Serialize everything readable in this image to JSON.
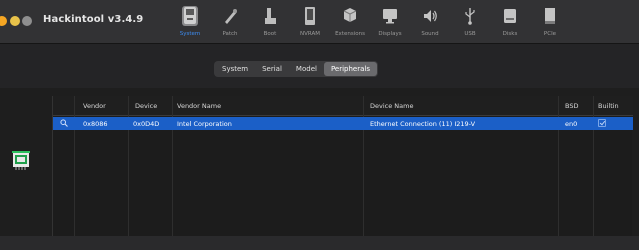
{
  "app": {
    "title": "Hackintool v3.4.9"
  },
  "toolbar": {
    "items": [
      {
        "label": "System",
        "icon": "system-icon",
        "active": true
      },
      {
        "label": "Patch",
        "icon": "patch-icon"
      },
      {
        "label": "Boot",
        "icon": "boot-icon"
      },
      {
        "label": "NVRAM",
        "icon": "nvram-icon"
      },
      {
        "label": "Extensions",
        "icon": "extensions-icon"
      },
      {
        "label": "Displays",
        "icon": "displays-icon"
      },
      {
        "label": "Sound",
        "icon": "sound-icon"
      },
      {
        "label": "USB",
        "icon": "usb-icon"
      },
      {
        "label": "Disks",
        "icon": "disks-icon"
      },
      {
        "label": "PCIe",
        "icon": "pcie-icon"
      }
    ],
    "accent": "#3d8cf0"
  },
  "tabs": {
    "items": [
      {
        "label": "System"
      },
      {
        "label": "Serial"
      },
      {
        "label": "Model"
      },
      {
        "label": "Peripherals",
        "active": true
      }
    ]
  },
  "table": {
    "columns": [
      "Vendor",
      "Device",
      "Vendor Name",
      "Device Name",
      "BSD",
      "Builtin"
    ],
    "rows": [
      {
        "vendor": "0x8086",
        "device": "0x0D4D",
        "vendor_name": "Intel Corporation",
        "device_name": "Ethernet Connection (11) I219-V",
        "bsd": "en0",
        "builtin": true,
        "selected": true
      }
    ],
    "selection_color": "#1b5fc7"
  },
  "sidebar": {
    "icon": "network-card-icon"
  }
}
